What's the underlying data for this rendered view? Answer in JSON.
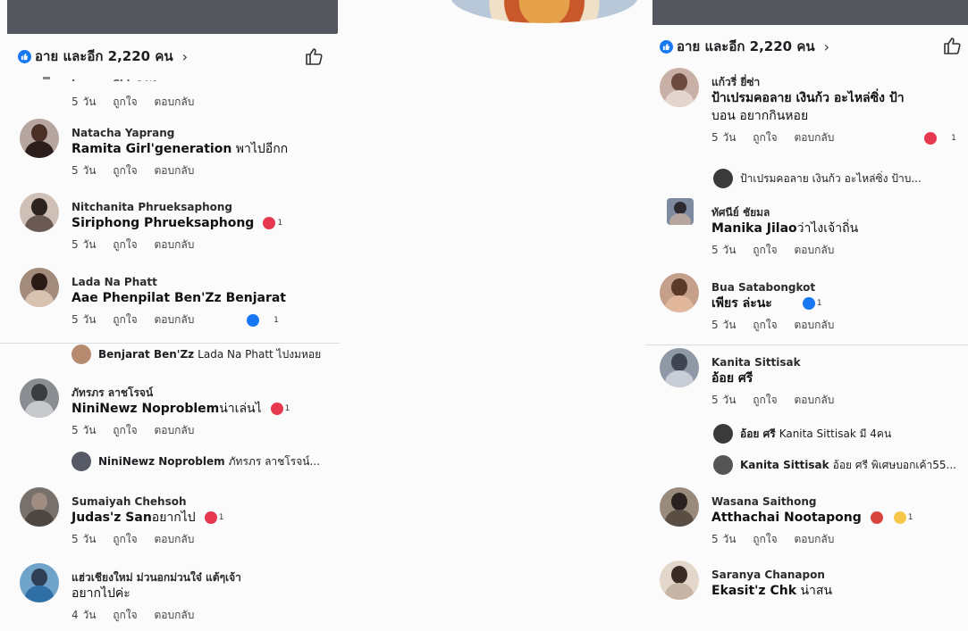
{
  "colors": {
    "like_blue": "#1877f2",
    "heart_red": "#e63950",
    "top_bar": "#53575d"
  },
  "left": {
    "reactions_label": "อาย และอีก 2,220 คน",
    "chevron": "›",
    "partial_name": "Lauruz Chk ร พก",
    "partial_meta": [
      "5 วัน",
      "ถูกใจ",
      "ตอบกลับ"
    ],
    "comments": [
      {
        "name": "Natacha Yaprang",
        "mention": "Ramita Girl'generation",
        "text": " พาไปอีกก",
        "meta": [
          "5 วัน",
          "ถูกใจ",
          "ตอบกลับ"
        ]
      },
      {
        "name": "Nitchanita Phrueksaphong",
        "mention": "Siriphong Phrueksaphong",
        "text": "",
        "meta": [
          "5 วัน",
          "ถูกใจ",
          "ตอบกลับ"
        ],
        "reaction": "1"
      },
      {
        "name": "Lada Na Phatt",
        "mention": "Aae Phenpilat Ben'Zz Benjarat",
        "text": "",
        "meta": [
          "5 วัน",
          "ถูกใจ",
          "ตอบกลับ"
        ],
        "reaction": "1"
      },
      {
        "name": "ภัทรภร ลาชโรจน์",
        "mention": "NiniNewz Noproblem",
        "text": "น่าเล่นไ",
        "meta": [
          "5 วัน",
          "ถูกใจ",
          "ตอบกลับ"
        ],
        "reaction": "1"
      },
      {
        "name": "Sumaiyah Chehsoh",
        "mention": "Judas'z San",
        "text": "อยากไป",
        "meta": [
          "5 วัน",
          "ถูกใจ",
          "ตอบกลับ"
        ],
        "reaction": "1"
      },
      {
        "name": "แฮ่วเชียงใหม่ ม่วนอกม่วนใจ๋ แต้ๆเจ้า",
        "mention": "",
        "text": "อยากไปค่ะ",
        "meta": [
          "4 วัน",
          "ถูกใจ",
          "ตอบกลับ"
        ]
      }
    ],
    "replies": [
      {
        "author": "Benjarat Ben'Zz",
        "text": "Lada Na Phatt ไปงมหอย"
      },
      {
        "author": "NiniNewz Noproblem",
        "text": "ภัทรภร ลาชโรจน์..."
      }
    ]
  },
  "right": {
    "reactions_label": "อาย และอีก 2,220 คน",
    "chevron": "›",
    "comments": [
      {
        "name": "แก้วรี่ ยี่ซ่า",
        "text": "ป้าเปรมคอลาย เงินก้ว อะไหล่ซิ่ง ป้า",
        "text2": "บอน อยากกินหอย",
        "meta": [
          "5 วัน",
          "ถูกใจ",
          "ตอบกลับ"
        ],
        "reaction": "1"
      },
      {
        "name": "ทัศนีย์ ชัยมล",
        "mention": "Manika Jilao",
        "text": "ว่าไงเจ้าถิ่น",
        "meta": [
          "5 วัน",
          "ถูกใจ",
          "ตอบกลับ"
        ]
      },
      {
        "name": "Bua Satabongkot",
        "mention": "เพียร ล่ะนะ",
        "text": "",
        "meta": [
          "5 วัน",
          "ถูกใจ",
          "ตอบกลับ"
        ],
        "reaction": "1"
      },
      {
        "name": "Kanita Sittisak",
        "mention": "อ้อย ศรี",
        "text": "",
        "meta": [
          "5 วัน",
          "ถูกใจ",
          "ตอบกลับ"
        ]
      },
      {
        "name": "Wasana Saithong",
        "mention": "Atthachai Nootapong",
        "text": "",
        "meta": [
          "5 วัน",
          "ถูกใจ",
          "ตอบกลับ"
        ],
        "reaction": "1"
      },
      {
        "name": "Saranya Chanapon",
        "mention": "Ekasit'z Chk",
        "text": " น่าสน",
        "meta": []
      }
    ],
    "replies": [
      {
        "author": "",
        "text": "ป้าเปรมคอลาย เงินก้ว อะไหล่ซิ่ง ป้าบ..."
      },
      {
        "author": "อ้อย ศรี",
        "text": "Kanita Sittisak มี 4คน"
      },
      {
        "author": "Kanita Sittisak",
        "text": "อ้อย ศรี  พิเศษบอกเค้า55..."
      }
    ]
  }
}
